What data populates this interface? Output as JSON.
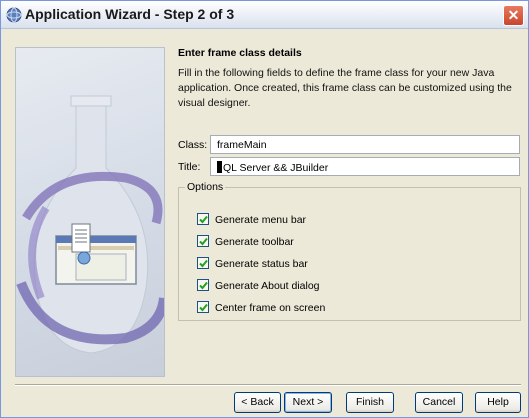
{
  "window": {
    "title": "Application Wizard - Step 2 of 3",
    "close_label": "✕",
    "icon": "wizard-app-icon"
  },
  "content": {
    "heading": "Enter frame class details",
    "description": "Fill in the following fields to define the frame class for your new Java application. Once created, this frame class can be customized using the visual designer."
  },
  "form": {
    "class_label": "Class:",
    "class_value": "frameMain",
    "title_label": "Title:",
    "title_value": "QL Server && JBuilder"
  },
  "options": {
    "legend": "Options",
    "items": [
      {
        "label": "Generate menu bar",
        "checked": true
      },
      {
        "label": "Generate toolbar",
        "checked": true
      },
      {
        "label": "Generate status bar",
        "checked": true
      },
      {
        "label": "Generate About dialog",
        "checked": true
      },
      {
        "label": "Center frame on screen",
        "checked": true
      }
    ]
  },
  "buttons": {
    "back": "< Back",
    "next": "Next >",
    "finish": "Finish",
    "cancel": "Cancel",
    "help": "Help"
  }
}
